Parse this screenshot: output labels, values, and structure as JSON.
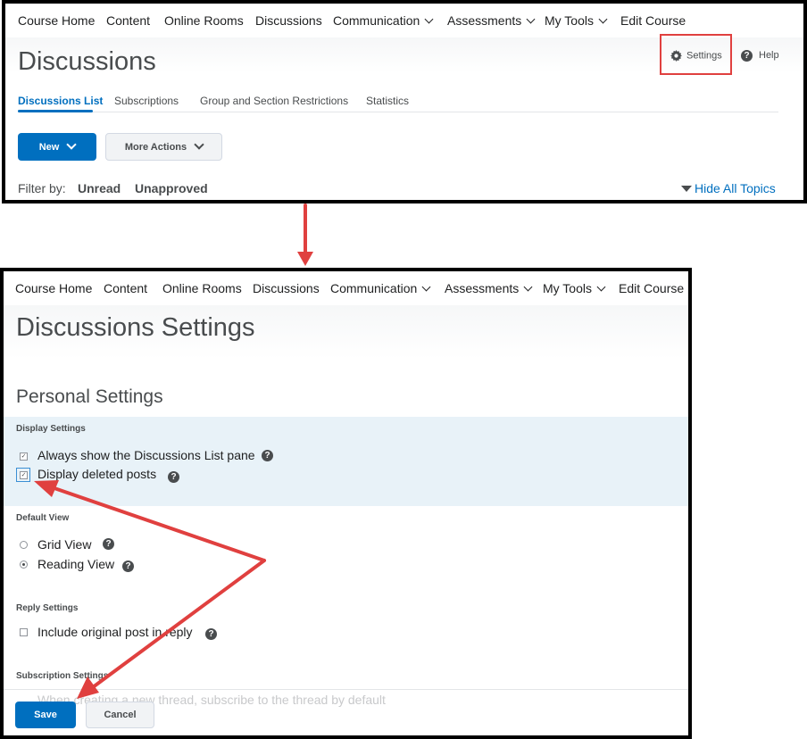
{
  "nav": {
    "items": [
      "Course Home",
      "Content",
      "Online Rooms",
      "Discussions",
      "Communication",
      "Assessments",
      "My Tools",
      "Edit Course"
    ]
  },
  "discussions": {
    "title": "Discussions",
    "settings_label": "Settings",
    "help_label": "Help",
    "tabs": [
      "Discussions List",
      "Subscriptions",
      "Group and Section Restrictions",
      "Statistics"
    ],
    "new_button": "New",
    "more_actions_button": "More Actions",
    "filter_label": "Filter by:",
    "filter_unread": "Unread",
    "filter_unapproved": "Unapproved",
    "hide_all_topics": "Hide All Topics"
  },
  "settings_page": {
    "title": "Discussions Settings",
    "personal_settings": "Personal Settings",
    "display_settings": {
      "label": "Display Settings",
      "always_show": "Always show the Discussions List pane",
      "display_deleted": "Display deleted posts"
    },
    "default_view": {
      "label": "Default View",
      "grid": "Grid View",
      "reading": "Reading View",
      "selected": "Reading View"
    },
    "reply_settings": {
      "label": "Reply Settings",
      "include_original": "Include original post in reply"
    },
    "subscription_settings": {
      "label": "Subscription Settings",
      "subscribe_default": "When creating a new thread, subscribe to the thread by default"
    },
    "save_button": "Save",
    "cancel_button": "Cancel"
  },
  "colors": {
    "accent": "#006fbf",
    "annotation": "#e0403f"
  },
  "icons": [
    "gear-icon",
    "help-icon",
    "chevron-down-icon",
    "triangle-down-icon",
    "question-icon"
  ]
}
